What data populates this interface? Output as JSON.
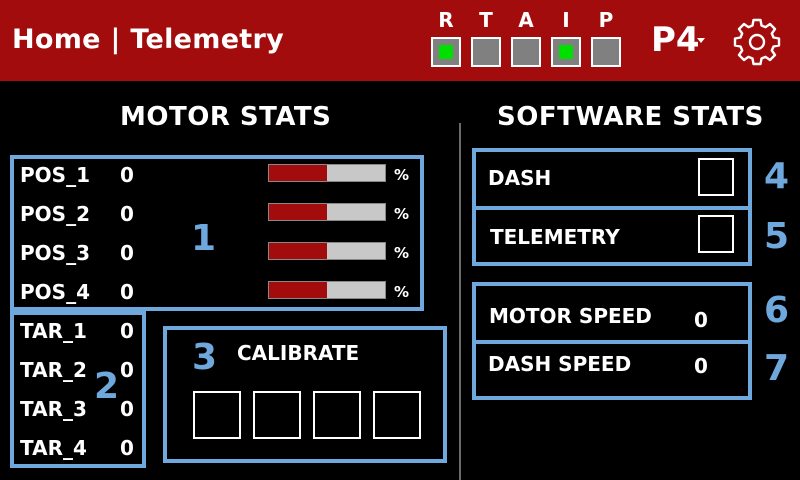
{
  "header": {
    "title": "Home | Telemetry",
    "indicators": [
      {
        "label": "R",
        "on": true
      },
      {
        "label": "T",
        "on": false
      },
      {
        "label": "A",
        "on": false
      },
      {
        "label": "I",
        "on": true
      },
      {
        "label": "P",
        "on": false
      }
    ],
    "profile": "P4",
    "settings_icon": "gear-icon"
  },
  "motor_stats": {
    "title": "MOTOR STATS",
    "group1_number": "1",
    "positions": [
      {
        "label": "POS_1",
        "value": "0",
        "percent": 0.5,
        "unit": "%"
      },
      {
        "label": "POS_2",
        "value": "0",
        "percent": 0.5,
        "unit": "%"
      },
      {
        "label": "POS_3",
        "value": "0",
        "percent": 0.5,
        "unit": "%"
      },
      {
        "label": "POS_4",
        "value": "0",
        "percent": 0.5,
        "unit": "%"
      }
    ],
    "group2_number": "2",
    "targets": [
      {
        "label": "TAR_1",
        "value": "0"
      },
      {
        "label": "TAR_2",
        "value": "0"
      },
      {
        "label": "TAR_3",
        "value": "0"
      },
      {
        "label": "TAR_4",
        "value": "0"
      }
    ],
    "calibrate": {
      "number": "3",
      "label": "CALIBRATE",
      "buttons": 4
    }
  },
  "software_stats": {
    "title": "SOFTWARE STATS",
    "toggles": [
      {
        "label": "DASH",
        "number": "4",
        "checked": false
      },
      {
        "label": "TELEMETRY",
        "number": "5",
        "checked": false
      }
    ],
    "speeds": [
      {
        "label": "MOTOR SPEED",
        "value": "0",
        "number": "6"
      },
      {
        "label": "DASH SPEED",
        "value": "0",
        "number": "7"
      }
    ]
  },
  "colors": {
    "header_bg": "#a30c0c",
    "accent_blue": "#6fa8dc",
    "indicator_on": "#00e000",
    "indicator_off": "#808080",
    "bar_fill": "#a30c0c",
    "bar_track": "#c8c8c8"
  }
}
